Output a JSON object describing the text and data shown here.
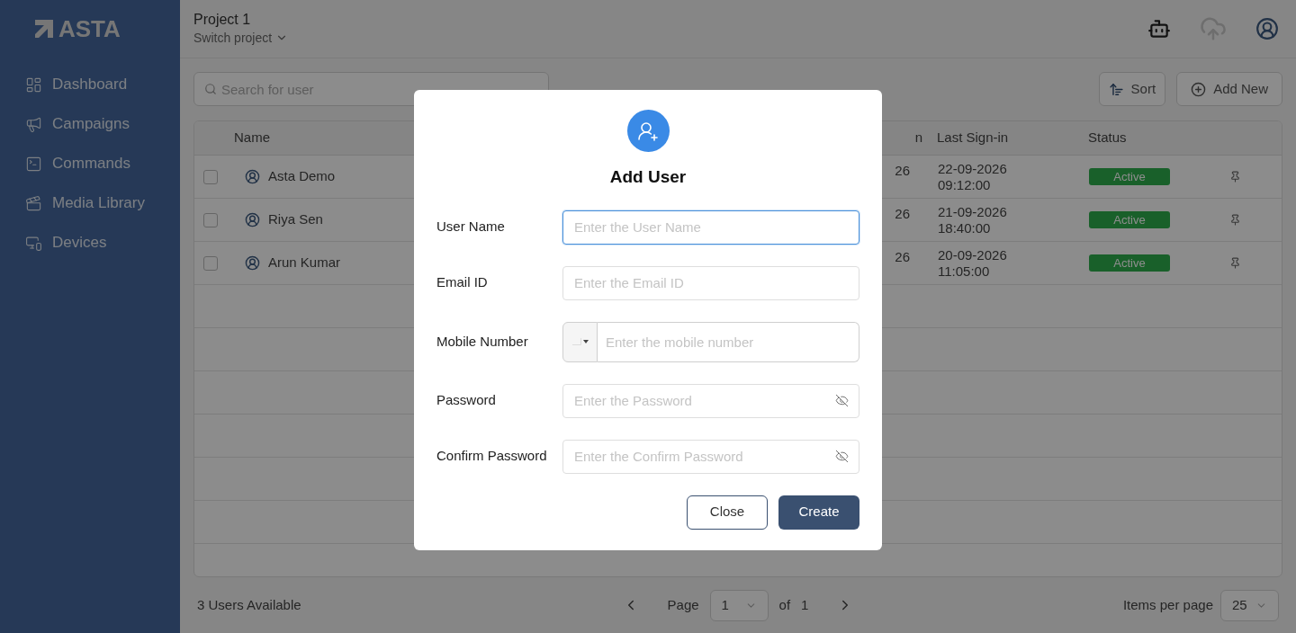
{
  "sidebar": {
    "logo": "ASTA",
    "items": [
      {
        "label": "Dashboard"
      },
      {
        "label": "Campaigns"
      },
      {
        "label": "Commands"
      },
      {
        "label": "Media Library"
      },
      {
        "label": "Devices"
      }
    ]
  },
  "header": {
    "project": "Project 1",
    "switch": "Switch project"
  },
  "toolbar": {
    "search": {
      "placeholder": "Search for user"
    },
    "sort": "Sort",
    "add": "Add New"
  },
  "table": {
    "columns": [
      "Name",
      "n",
      "Last Sign-in",
      "Status"
    ],
    "rows": [
      {
        "name": "Asta Demo",
        "column_2": "26",
        "last_sign_in": [
          "22-09-2026",
          "09:12:00"
        ],
        "status": "Active",
        "checked": false
      },
      {
        "name": "Riya Sen",
        "column_2": "26",
        "last_sign_in": [
          "21-09-2026",
          "18:40:00"
        ],
        "status": "Active",
        "checked": false
      },
      {
        "name": "Arun Kumar",
        "column_2": "26",
        "last_sign_in": [
          "20-09-2026",
          "11:05:00"
        ],
        "status": "Active",
        "checked": false
      }
    ]
  },
  "footer": {
    "count": "3 Users Available",
    "page_label": "Page",
    "page": "1",
    "of": "of",
    "total": "1",
    "per_page_label": "Items per page",
    "per_page": "25"
  },
  "dialog": {
    "title": "Add User",
    "fields": [
      {
        "label": "User Name",
        "placeholder": "Enter the User Name",
        "kind": "text",
        "focused": true
      },
      {
        "label": "Email ID",
        "placeholder": "Enter the Email ID",
        "kind": "text",
        "focused": false
      },
      {
        "label": "Mobile Number",
        "placeholder": "Enter the mobile number",
        "kind": "phone",
        "focused": false
      },
      {
        "label": "Password",
        "placeholder": "Enter the Password",
        "kind": "password",
        "focused": false
      },
      {
        "label": "Confirm Password",
        "placeholder": "Enter the Confirm Password",
        "kind": "password",
        "focused": false
      }
    ],
    "buttons": [
      "Close",
      "Create"
    ]
  }
}
